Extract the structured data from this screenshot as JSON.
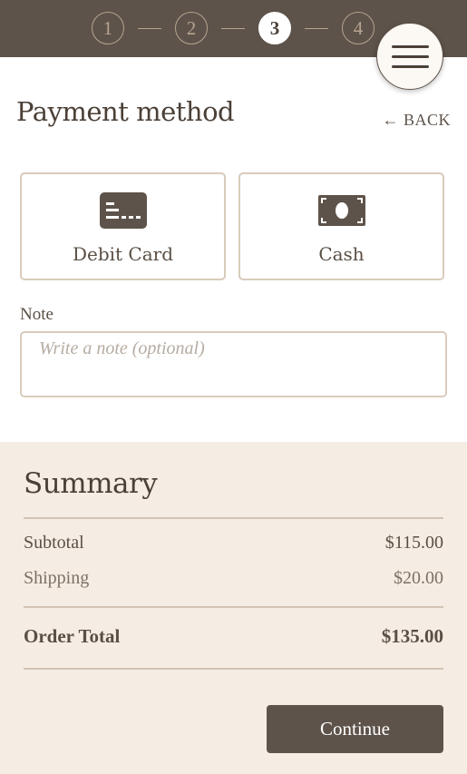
{
  "stepper": {
    "steps": [
      "1",
      "2",
      "3",
      "4"
    ],
    "active_step": "3"
  },
  "menu": {
    "icon": "hamburger-icon"
  },
  "header": {
    "title": "Payment method",
    "back_label": "← BACK"
  },
  "payment_options": [
    {
      "label": "Debit Card",
      "icon": "credit-card-icon"
    },
    {
      "label": "Cash",
      "icon": "banknote-icon"
    }
  ],
  "note": {
    "label": "Note",
    "placeholder": "Write a note (optional)",
    "value": ""
  },
  "summary": {
    "title": "Summary",
    "subtotal_label": "Subtotal",
    "subtotal_value": "$115.00",
    "shipping_label": "Shipping",
    "shipping_value": "$20.00",
    "total_label": "Order Total",
    "total_value": "$135.00"
  },
  "actions": {
    "continue_label": "Continue"
  },
  "colors": {
    "header_bg": "#5e534a",
    "summary_bg": "#f5ede4",
    "border": "#d9cbbb",
    "text": "#5a4f45"
  }
}
